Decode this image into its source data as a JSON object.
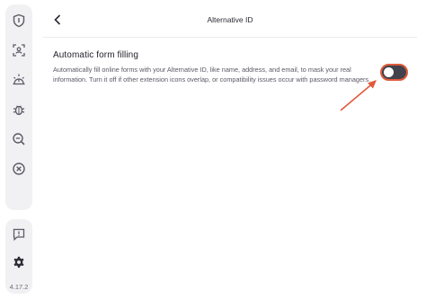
{
  "header": {
    "title": "Alternative ID",
    "back_icon": "chevron-left-icon"
  },
  "sidebar": {
    "items": [
      {
        "icon": "shield-icon"
      },
      {
        "icon": "user-scan-icon"
      },
      {
        "icon": "sun-alert-icon"
      },
      {
        "icon": "bug-icon"
      },
      {
        "icon": "search-minus-icon"
      },
      {
        "icon": "close-circle-icon"
      }
    ],
    "bottom_items": [
      {
        "icon": "feedback-icon"
      },
      {
        "icon": "gear-icon"
      }
    ],
    "version": "4.17.2"
  },
  "setting": {
    "title": "Automatic form filling",
    "description": "Automatically fill online forms with your Alternative ID, like name, address, and email, to mask your real information. Turn it off if other extension icons overlap, or compatibility issues occur with password managers.",
    "toggle_state": "off"
  },
  "colors": {
    "accent": "#e05a3c",
    "toggle_track": "#42424d",
    "sidebar_bg": "#f1f1f4"
  }
}
